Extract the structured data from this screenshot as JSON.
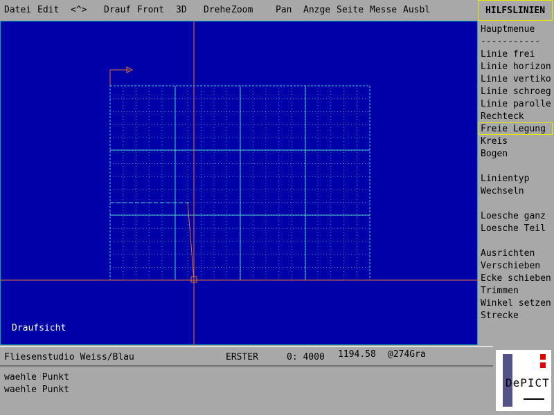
{
  "menu": {
    "datei": "Datei",
    "edit": "Edit",
    "back": "<^>",
    "drauf": "Drauf",
    "front": "Front",
    "view3d": "3D",
    "drehe": "Drehe",
    "zoom": "Zoom",
    "pan": "Pan",
    "anzge": "Anzge",
    "seite": "Seite",
    "messe": "Messe",
    "ausbl": "Ausbl"
  },
  "panel": {
    "title": "HILFSLINIEN",
    "items": [
      "Hauptmenue",
      "-----------",
      "Linie frei",
      "Linie horizon",
      "Linie vertiko",
      "Linie schroeg",
      "Linie parolle",
      "Rechteck",
      "Freie Legung",
      "Kreis",
      "Bogen",
      "",
      "Linientyp",
      "Wechseln",
      "",
      "Loesche ganz",
      "Loesche Teil",
      "",
      "Ausrichten",
      "Verschieben",
      "Ecke schieben",
      "Trimmen",
      "Winkel setzen",
      "Strecke"
    ],
    "selected": "Freie Legung"
  },
  "canvas": {
    "view_label": "Draufsicht",
    "colors": {
      "background": "#0000a8",
      "grid": "#00a8a8",
      "axis": "#e07030",
      "grid_major": "#40d0d0"
    }
  },
  "status": {
    "project": "Fliesenstudio Weiss/Blau",
    "layer": "ERSTER",
    "o_label": "0: 4000",
    "coord": "1194.58",
    "angle": "@274Gra"
  },
  "command": {
    "lines": [
      "waehle Punkt",
      "waehle Punkt"
    ]
  },
  "logo": {
    "text": "DePICT"
  }
}
